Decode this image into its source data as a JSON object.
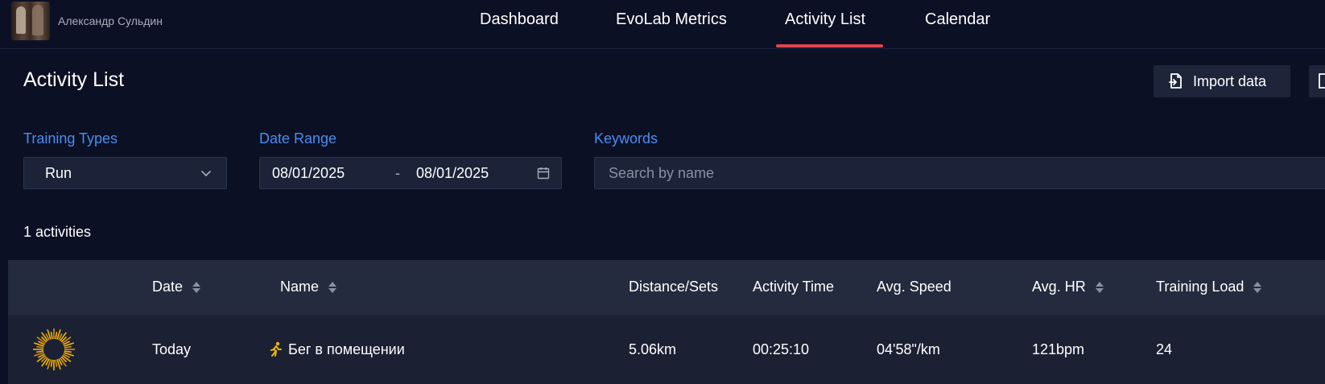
{
  "user": {
    "name": "Александр Сульдин"
  },
  "nav": [
    {
      "label": "Dashboard",
      "active": false
    },
    {
      "label": "EvoLab Metrics",
      "active": false
    },
    {
      "label": "Activity List",
      "active": true
    },
    {
      "label": "Calendar",
      "active": false
    }
  ],
  "accent_color": "#e0454e",
  "label_color": "#4a8df0",
  "page": {
    "title": "Activity List",
    "import_label": "Import data"
  },
  "filters": {
    "training_types_label": "Training Types",
    "training_type_value": "Run",
    "date_range_label": "Date Range",
    "date_from": "08/01/2025",
    "date_separator": "-",
    "date_to": "08/01/2025",
    "keywords_label": "Keywords",
    "keywords_placeholder": "Search by name",
    "keywords_value": ""
  },
  "summary": {
    "count_text": "1 activities"
  },
  "table": {
    "columns": [
      {
        "label": "Date",
        "sortable": true
      },
      {
        "label": "Name",
        "sortable": true
      },
      {
        "label": "Distance/Sets",
        "sortable": false
      },
      {
        "label": "Activity Time",
        "sortable": false
      },
      {
        "label": "Avg. Speed",
        "sortable": false
      },
      {
        "label": "Avg. HR",
        "sortable": true
      },
      {
        "label": "Training Load",
        "sortable": true
      }
    ],
    "rows": [
      {
        "icon": "sun-burst-icon",
        "date": "Today",
        "type_icon": "running-icon",
        "name": "Бег в помещении",
        "distance": "5.06km",
        "time": "00:25:10",
        "speed": "04'58\"/km",
        "hr": "121bpm",
        "load": "24"
      }
    ]
  }
}
